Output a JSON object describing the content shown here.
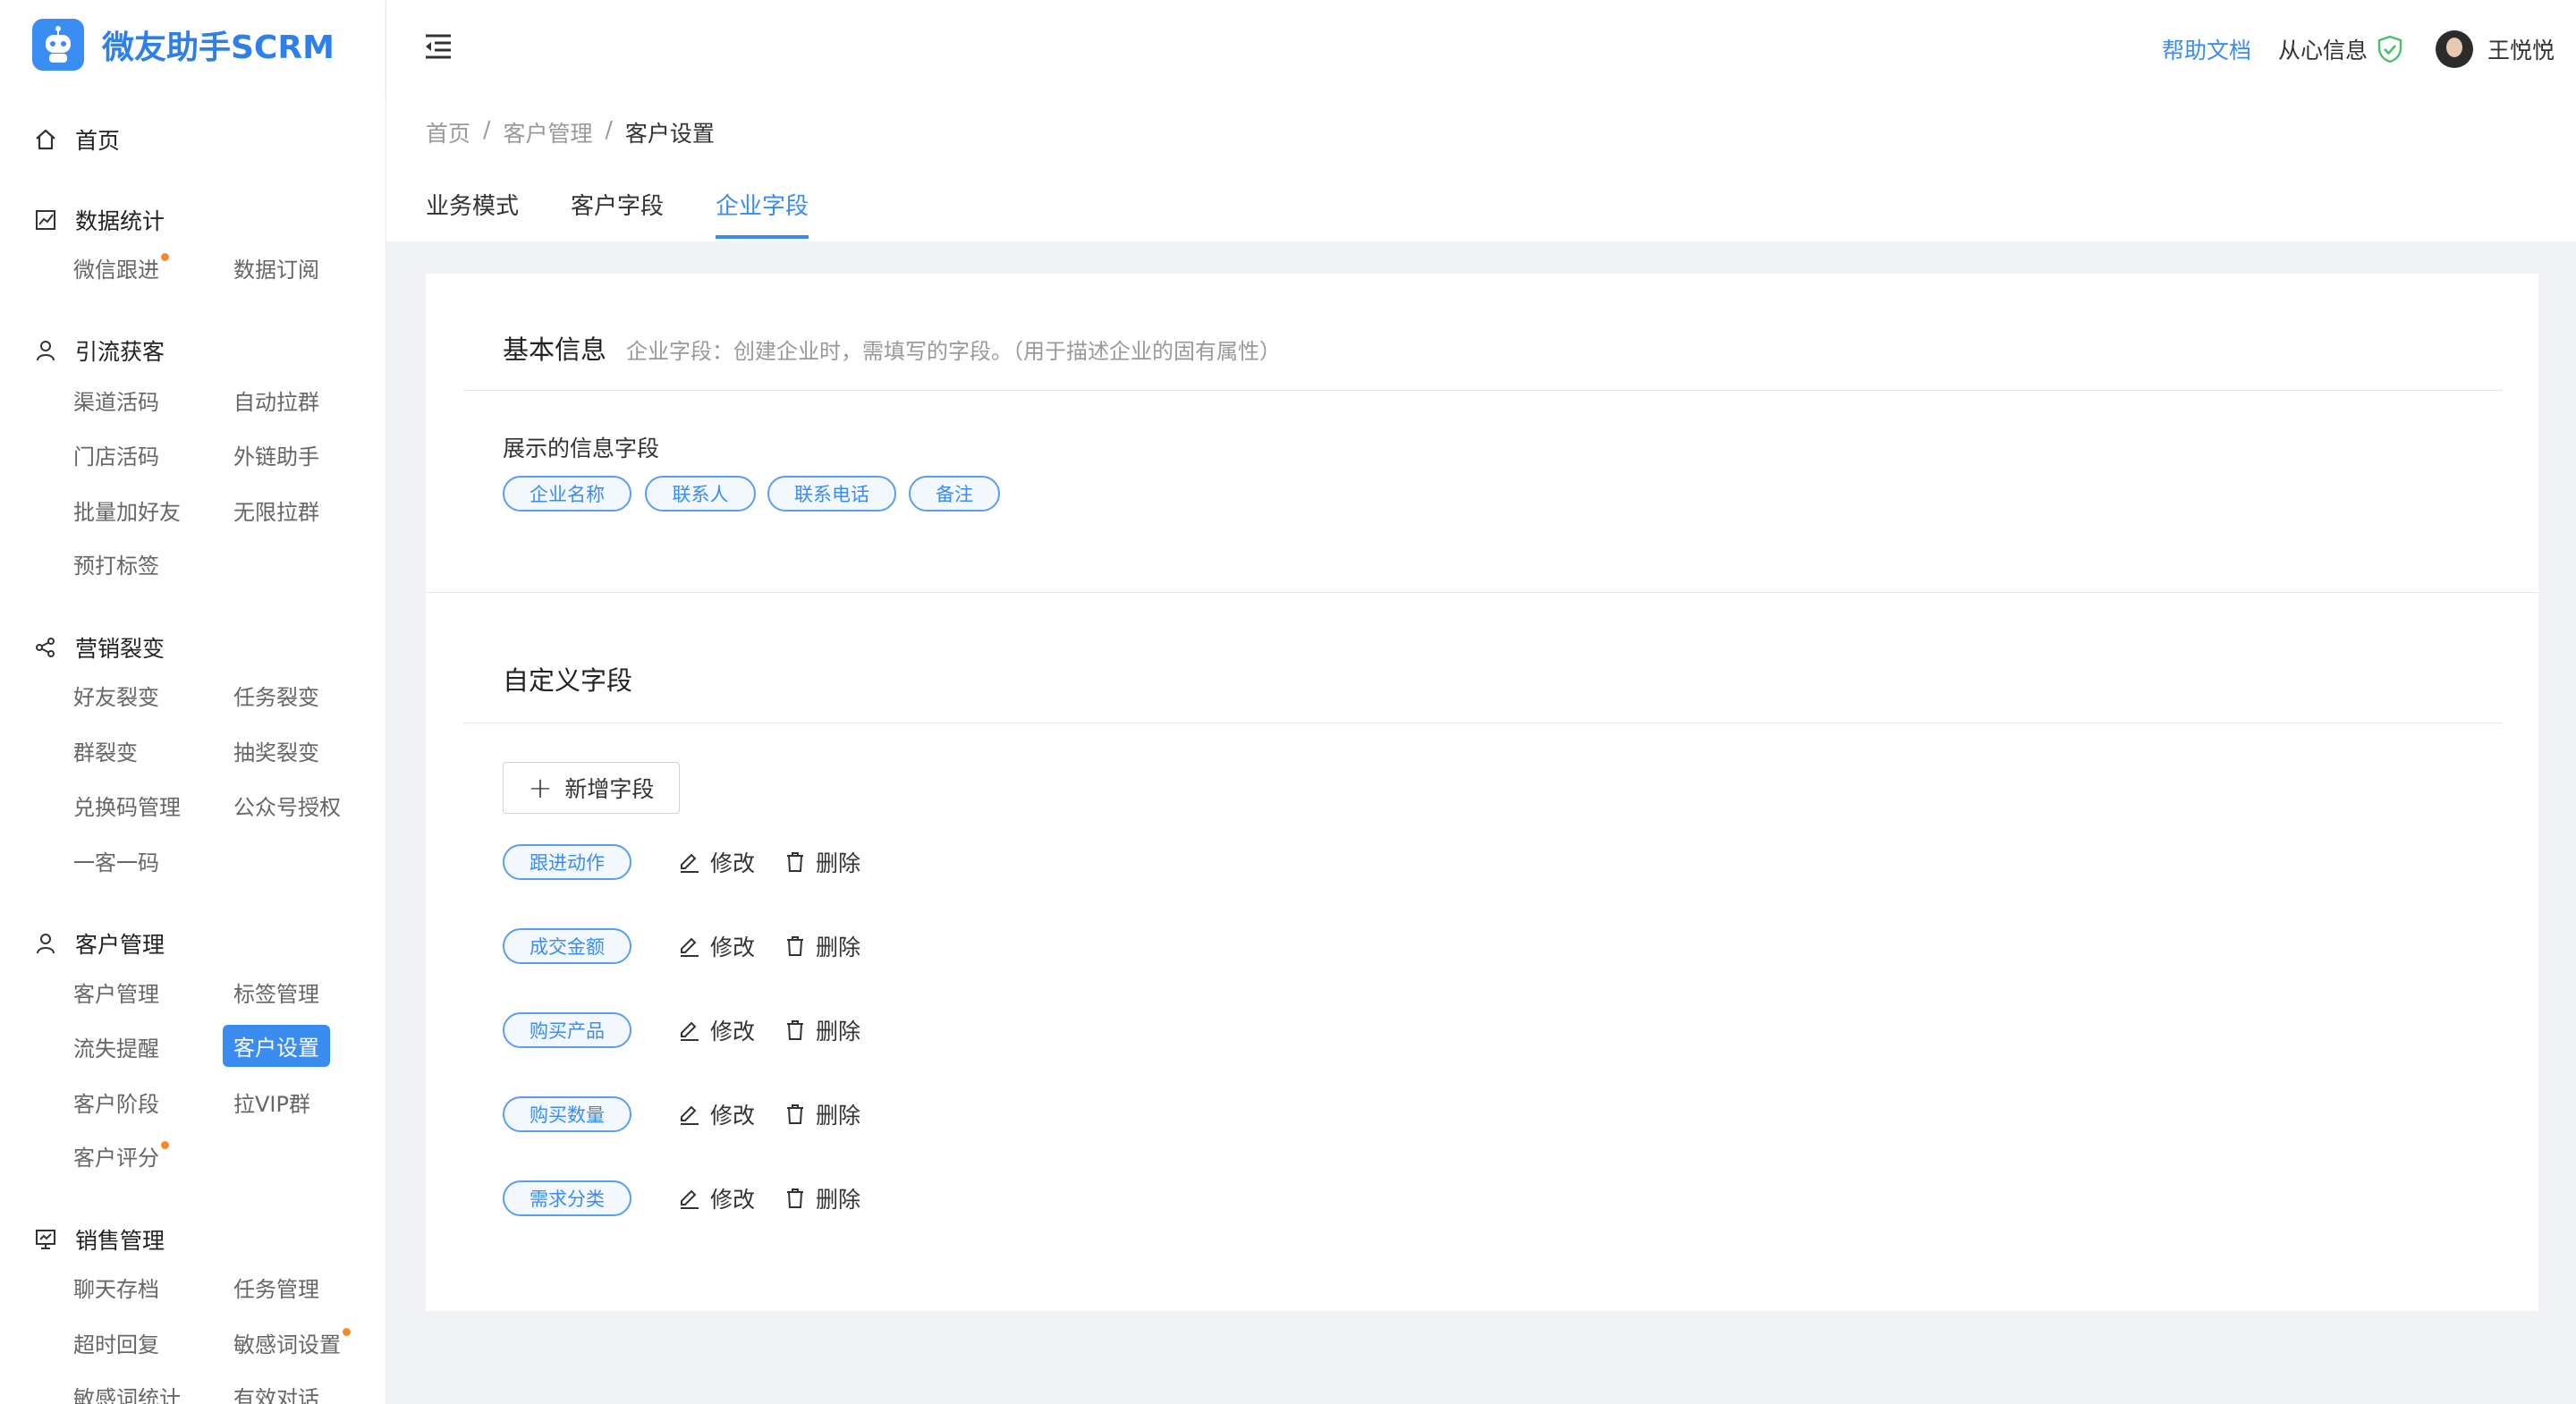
{
  "app": {
    "name": "微友助手SCRM",
    "brand_color": "#3b8cf0"
  },
  "sidebar": {
    "home": "首页",
    "groups": [
      {
        "title": "数据统计",
        "icon": "chart-icon",
        "items": [
          "微信跟进",
          "数据订阅"
        ]
      },
      {
        "title": "引流获客",
        "icon": "user-icon",
        "items": [
          "渠道活码",
          "自动拉群",
          "门店活码",
          "外链助手",
          "批量加好友",
          "无限拉群",
          "预打标签"
        ]
      },
      {
        "title": "营销裂变",
        "icon": "share-icon",
        "items": [
          "好友裂变",
          "任务裂变",
          "群裂变",
          "抽奖裂变",
          "兑换码管理",
          "公众号授权",
          "一客一码"
        ]
      },
      {
        "title": "客户管理",
        "icon": "user-icon",
        "items": [
          "客户管理",
          "标签管理",
          "流失提醒",
          "客户设置",
          "客户阶段",
          "拉VIP群",
          "客户评分"
        ]
      },
      {
        "title": "销售管理",
        "icon": "presentation-icon",
        "items": [
          "聊天存档",
          "任务管理",
          "超时回复",
          "敏感词设置",
          "敏感词统计",
          "有效对话"
        ]
      }
    ]
  },
  "header": {
    "help": "帮助文档",
    "company": "从心信息",
    "username": "王悦悦"
  },
  "breadcrumb": [
    "首页",
    "客户管理",
    "客户设置"
  ],
  "tabs": [
    "业务模式",
    "客户字段",
    "企业字段"
  ],
  "active_tab": "企业字段",
  "basic": {
    "title": "基本信息",
    "desc": "企业字段：创建企业时，需填写的字段。（用于描述企业的固有属性）",
    "shown_label": "展示的信息字段",
    "fields": [
      "企业名称",
      "联系人",
      "联系电话",
      "备注"
    ]
  },
  "custom": {
    "title": "自定义字段",
    "add_label": "新增字段",
    "edit_label": "修改",
    "delete_label": "删除",
    "fields": [
      "跟进动作",
      "成交金额",
      "购买产品",
      "购买数量",
      "需求分类"
    ]
  }
}
